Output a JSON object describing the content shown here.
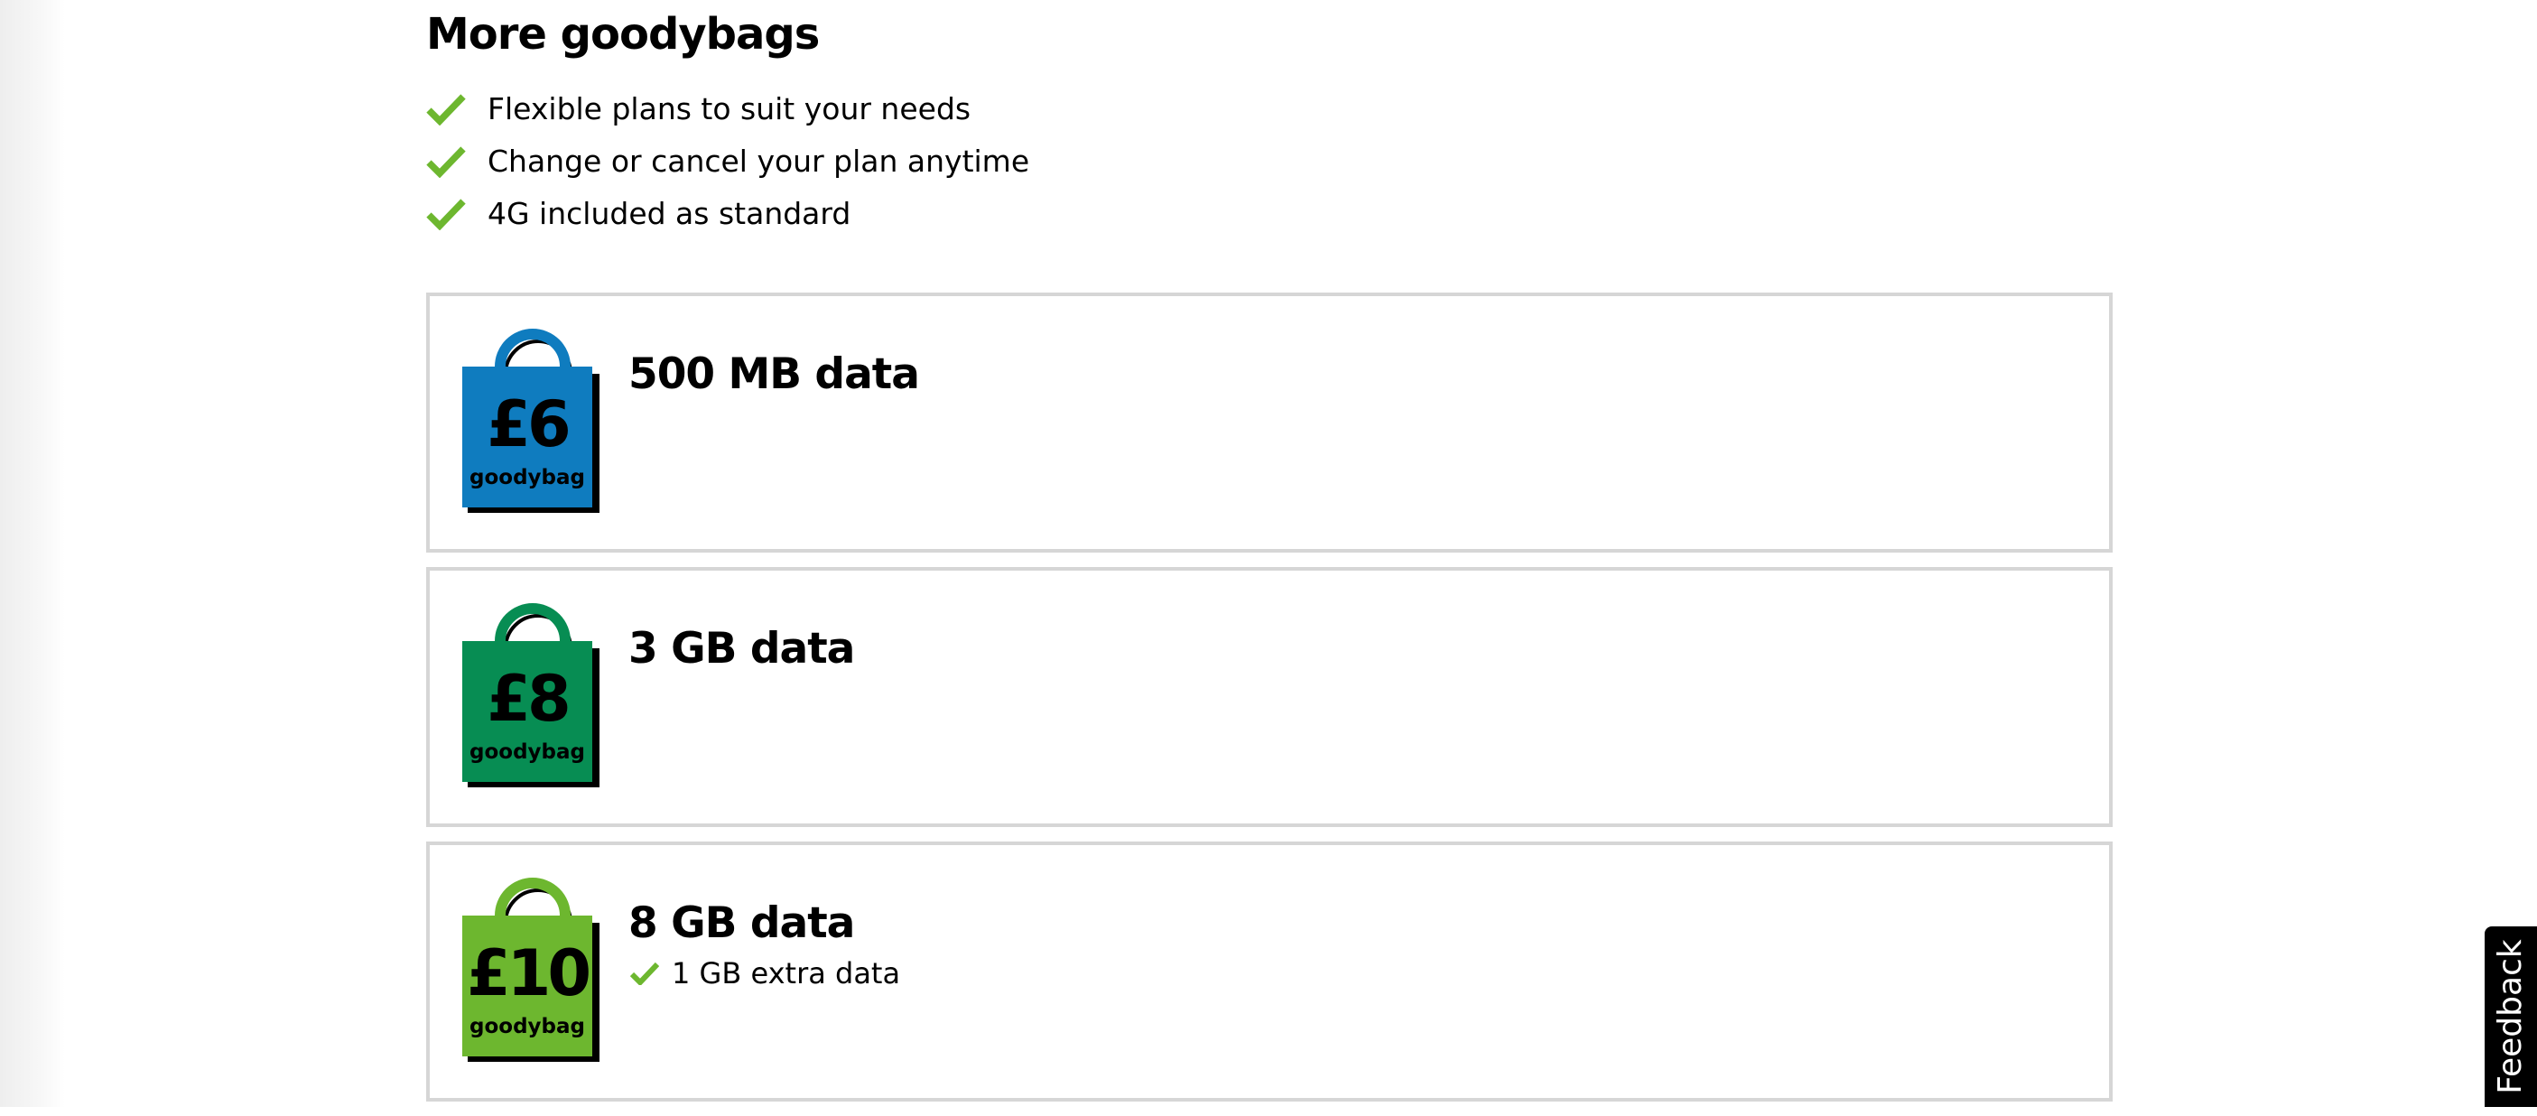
{
  "page": {
    "section_title": "More goodybags",
    "benefits": [
      "Flexible plans to suit your needs",
      "Change or cancel your plan anytime",
      "4G included as standard"
    ]
  },
  "plans": [
    {
      "price": "£6",
      "bag_label": "goodybag",
      "title": "500 MB data",
      "bag_color": "#0f7cbf",
      "extras": []
    },
    {
      "price": "£8",
      "bag_label": "goodybag",
      "title": "3 GB data",
      "bag_color": "#078d53",
      "extras": []
    },
    {
      "price": "£10",
      "bag_label": "goodybag",
      "title": "8 GB data",
      "bag_color": "#6db72f",
      "extras": [
        "1 GB extra data"
      ]
    }
  ],
  "feedback": {
    "label": "Feedback"
  },
  "colors": {
    "tick": "#6db72f",
    "card_border": "#d6d6d6"
  },
  "icons": {
    "benefit": "checkmark-icon",
    "plan": "goodybag-icon"
  }
}
